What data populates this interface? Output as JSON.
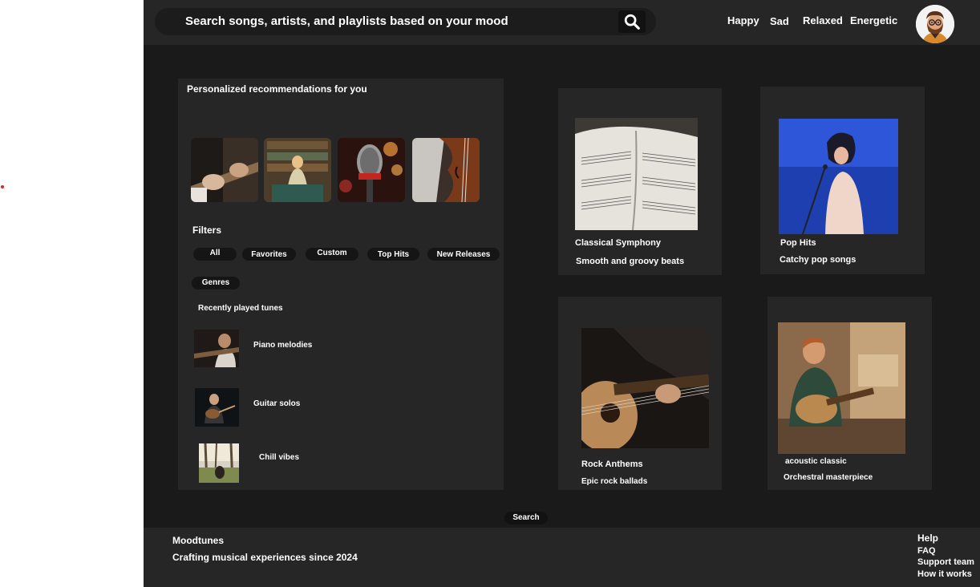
{
  "search": {
    "placeholder": "Search songs, artists, and playlists based on your mood",
    "icon": "search-icon"
  },
  "moods": [
    "Happy",
    "Sad",
    "Relaxed",
    "Energetic"
  ],
  "recommendations": {
    "title": "Personalized recommendations for you",
    "images": [
      "guitar-hands-image",
      "woman-music-store-image",
      "microphone-image",
      "violin-image"
    ]
  },
  "filters": {
    "title": "Filters",
    "chips": [
      "All",
      "Favorites",
      "Custom",
      "Top Hits",
      "New Releases"
    ],
    "genres": "Genres"
  },
  "recent": {
    "title": "Recently played tunes",
    "items": [
      {
        "label": "Piano melodies"
      },
      {
        "label": "Guitar solos"
      },
      {
        "label": "Chill vibes"
      }
    ]
  },
  "cards": [
    {
      "title": "Classical Symphony",
      "subtitle": "Smooth and groovy beats"
    },
    {
      "title": "Pop Hits",
      "subtitle": "Catchy pop songs"
    },
    {
      "title": "Rock Anthems",
      "subtitle": "Epic rock ballads"
    },
    {
      "title": "acoustic classic",
      "subtitle": "Orchestral masterpiece"
    }
  ],
  "search_button": "Search",
  "footer": {
    "brand": "Moodtunes",
    "tagline": "Crafting musical experiences since 2024",
    "help_title": "Help",
    "help_links": [
      "FAQ",
      "Support team",
      "How it works"
    ]
  },
  "colors": {
    "background": "#1a1a1a",
    "surface": "#262626",
    "chip": "#151515",
    "text": "#ffffff",
    "dot": "#e0232e"
  }
}
